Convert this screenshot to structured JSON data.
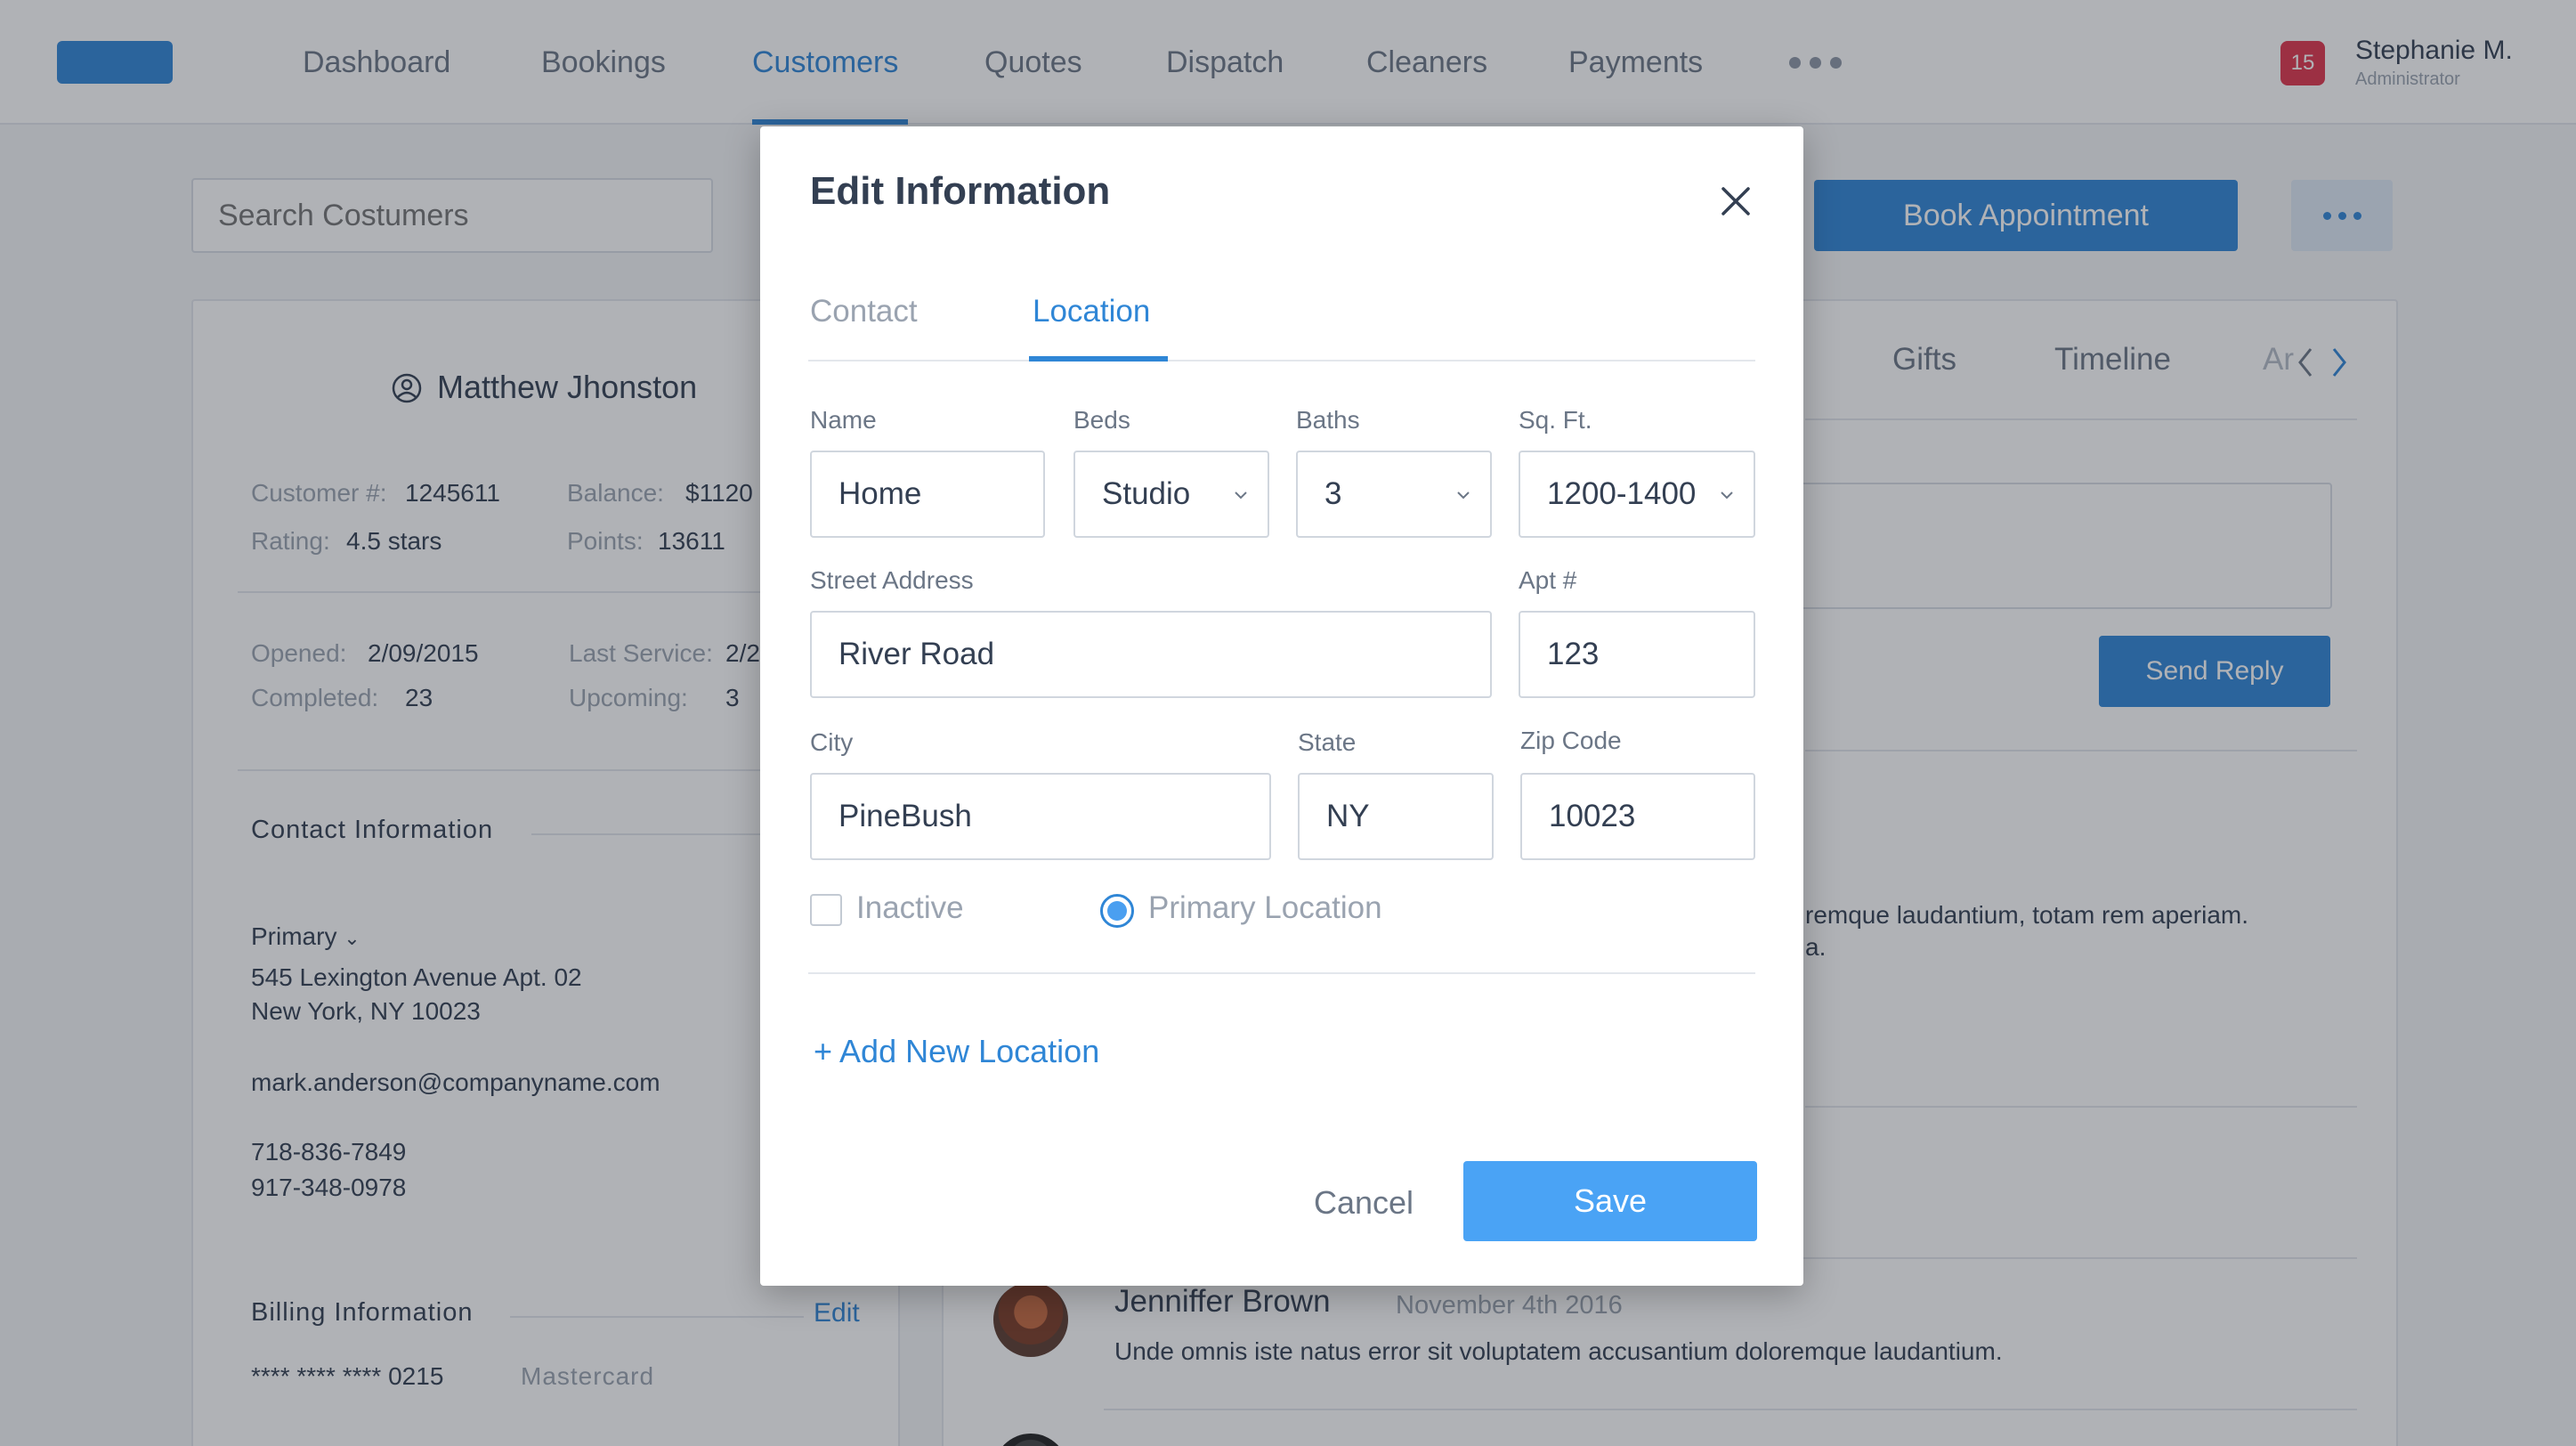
{
  "nav": {
    "items": [
      "Dashboard",
      "Bookings",
      "Customers",
      "Quotes",
      "Dispatch",
      "Cleaners",
      "Payments"
    ],
    "active": "Customers",
    "notification_count": "15",
    "user_name": "Stephanie M.",
    "user_role": "Administrator"
  },
  "toolbar": {
    "search_placeholder": "Search Costumers",
    "book_label": "Book Appointment"
  },
  "customer": {
    "name": "Matthew Jhonston",
    "customer_no_label": "Customer #:",
    "customer_no": "1245611",
    "balance_label": "Balance:",
    "balance": "$1120",
    "rating_label": "Rating:",
    "rating": "4.5 stars",
    "points_label": "Points:",
    "points": "13611",
    "opened_label": "Opened:",
    "opened": "2/09/2015",
    "last_service_label": "Last Service:",
    "last_service": "2/2",
    "completed_label": "Completed:",
    "completed": "23",
    "upcoming_label": "Upcoming:",
    "upcoming": "3",
    "contact_title": "Contact Information",
    "primary_label": "Primary",
    "address_line1": "545 Lexington Avenue Apt. 02",
    "address_line2": "New York, NY 10023",
    "email": "mark.anderson@companyname.com",
    "phone1": "718-836-7849",
    "phone2": "917-348-0978",
    "billing_title": "Billing Information",
    "billing_edit": "Edit",
    "card_number": "**** **** **** 0215",
    "card_type": "Mastercard"
  },
  "right": {
    "tabs": [
      "Gifts",
      "Timeline",
      "Ar"
    ],
    "send_reply": "Send Reply",
    "partial_comment_line1": "remque laudantium, totam rem aperiam.",
    "partial_comment_line2": "a.",
    "comment_name": "Jenniffer Brown",
    "comment_date": "November 4th 2016",
    "comment_text": "Unde omnis iste natus error sit voluptatem accusantium doloremque laudantium."
  },
  "modal": {
    "title": "Edit Information",
    "tabs": [
      "Contact",
      "Location"
    ],
    "active_tab": "Location",
    "fields": {
      "name_label": "Name",
      "name_value": "Home",
      "beds_label": "Beds",
      "beds_value": "Studio",
      "baths_label": "Baths",
      "baths_value": "3",
      "sqft_label": "Sq. Ft.",
      "sqft_value": "1200-1400",
      "street_label": "Street Address",
      "street_value": "River Road",
      "apt_label": "Apt #",
      "apt_value": "123",
      "city_label": "City",
      "city_value": "PineBush",
      "state_label": "State",
      "state_value": "NY",
      "zip_label": "Zip Code",
      "zip_value": "10023"
    },
    "inactive_label": "Inactive",
    "inactive_checked": false,
    "primary_location_label": "Primary Location",
    "primary_location_selected": true,
    "add_location": "+ Add New Location",
    "cancel": "Cancel",
    "save": "Save"
  },
  "colors": {
    "accent": "#2f86d6",
    "save_button": "#4aa3f5",
    "badge": "#e0354b"
  }
}
